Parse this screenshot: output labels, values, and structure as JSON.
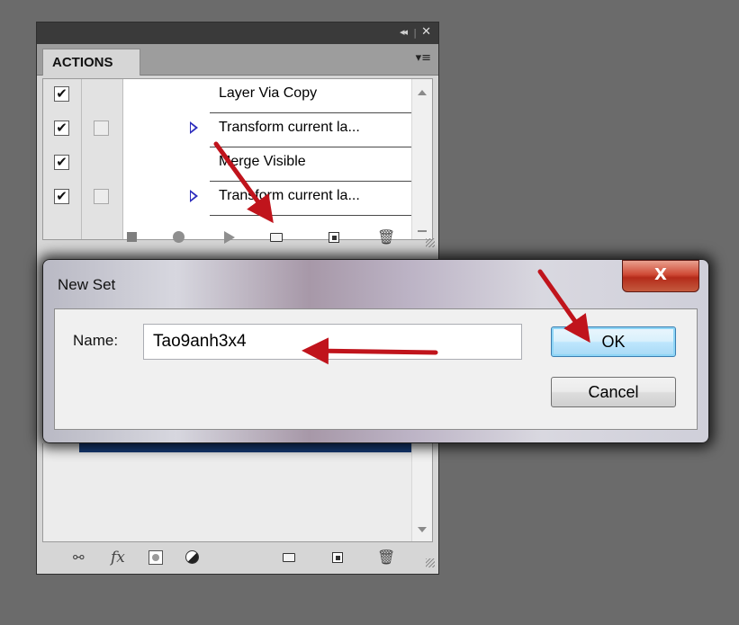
{
  "panel": {
    "tab_label": "ACTIONS",
    "collapse_glyph": "◂◂",
    "separator_glyph": "|",
    "close_glyph": "✕",
    "menu_glyph": "▾≡",
    "actions": [
      {
        "label": "Layer Via Copy",
        "checked": true,
        "dialog_toggle": false,
        "expandable": false
      },
      {
        "label": "Transform current la...",
        "checked": true,
        "dialog_toggle": true,
        "expandable": true
      },
      {
        "label": "Merge Visible",
        "checked": true,
        "dialog_toggle": false,
        "expandable": false
      },
      {
        "label": "Transform current la...",
        "checked": true,
        "dialog_toggle": true,
        "expandable": true
      }
    ],
    "check_glyph": "✔",
    "toolbar_icons": [
      "stop-icon",
      "record-icon",
      "play-icon",
      "new-set-folder-icon",
      "new-action-icon",
      "delete-icon"
    ],
    "layers_toolbar_icons": [
      "link-layers-icon",
      "fx-icon",
      "layer-mask-icon",
      "adjustment-layer-icon",
      "folder-icon",
      "new-layer-icon",
      "delete-icon"
    ],
    "fx_text": "fx",
    "link_glyph": "⚯",
    "trash_glyph": "🗑"
  },
  "dialog": {
    "title": "New Set",
    "close_glyph": "X",
    "name_label": "Name:",
    "name_value": "Tao9anh3x4",
    "ok_label": "OK",
    "cancel_label": "Cancel"
  },
  "colors": {
    "arrow": "#c0141c",
    "selection": "#173c78",
    "close_button": "#c7432e",
    "expand_triangle": "#2d2dbd"
  }
}
